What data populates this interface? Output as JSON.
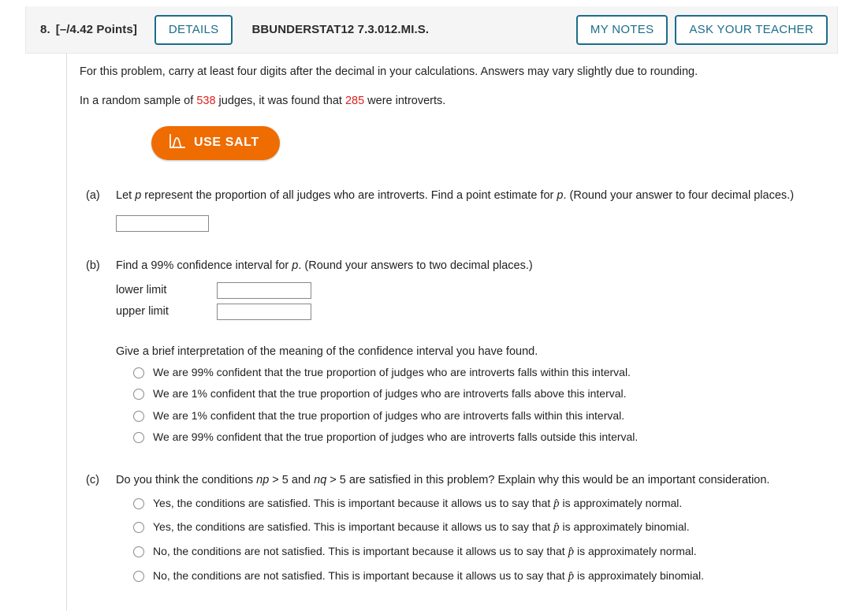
{
  "header": {
    "question_number": "8.",
    "points": "[–/4.42 Points]",
    "details_label": "DETAILS",
    "question_code": "BBUNDERSTAT12 7.3.012.MI.S.",
    "my_notes_label": "MY NOTES",
    "ask_teacher_label": "ASK YOUR TEACHER",
    "accent_color": "#1c6d8a",
    "bar_color": "#f5f5f5"
  },
  "intro": {
    "line1": "For this problem, carry at least four digits after the decimal in your calculations. Answers may vary slightly due to rounding.",
    "line2_pre": "In a random sample of ",
    "sample_size": "538",
    "line2_mid": " judges, it was found that ",
    "successes": "285",
    "line2_post": " were introverts.",
    "highlight_color": "#e02020"
  },
  "salt": {
    "label": "USE SALT",
    "icon": "distribution-curve-icon",
    "color": "#ef6c00"
  },
  "parts": {
    "a": {
      "label": "(a)",
      "prompt_1": "Let ",
      "prompt_var": "p",
      "prompt_2": " represent the proportion of all judges who are introverts. Find a point estimate for ",
      "prompt_var2": "p",
      "prompt_3": ". (Round your answer to four decimal places.)",
      "answer_value": "",
      "answer_placeholder": ""
    },
    "b": {
      "label": "(b)",
      "prompt_1": "Find a 99% confidence interval for ",
      "prompt_var": "p",
      "prompt_2": ". (Round your answers to two decimal places.)",
      "lower_limit_label": "lower limit",
      "lower_limit_value": "",
      "upper_limit_label": "upper limit",
      "upper_limit_value": "",
      "subprompt": "Give a brief interpretation of the meaning of the confidence interval you have found.",
      "options": [
        "We are 99% confident that the true proportion of judges who are introverts falls within this interval.",
        "We are 1% confident that the true proportion of judges who are introverts falls above this interval.",
        "We are 1% confident that the true proportion of judges who are introverts falls within this interval.",
        "We are 99% confident that the true proportion of judges who are introverts falls outside this interval."
      ]
    },
    "c": {
      "label": "(c)",
      "prompt_1": "Do you think the conditions ",
      "prompt_np": "np",
      "prompt_2": " > 5 and ",
      "prompt_nq": "nq",
      "prompt_3": " > 5 are satisfied in this problem? Explain why this would be an important consideration.",
      "options": [
        {
          "pre": "Yes, the conditions are satisfied. This is important because it allows us to say that ",
          "symbol": "p̂",
          "post": " is approximately normal."
        },
        {
          "pre": "Yes, the conditions are satisfied. This is important because it allows us to say that ",
          "symbol": "p̂",
          "post": " is approximately binomial."
        },
        {
          "pre": "No, the conditions are not satisfied. This is important because it allows us to say that ",
          "symbol": "p̂",
          "post": " is approximately normal."
        },
        {
          "pre": "No, the conditions are not satisfied. This is important because it allows us to say that ",
          "symbol": "p̂",
          "post": " is approximately binomial."
        }
      ]
    }
  }
}
